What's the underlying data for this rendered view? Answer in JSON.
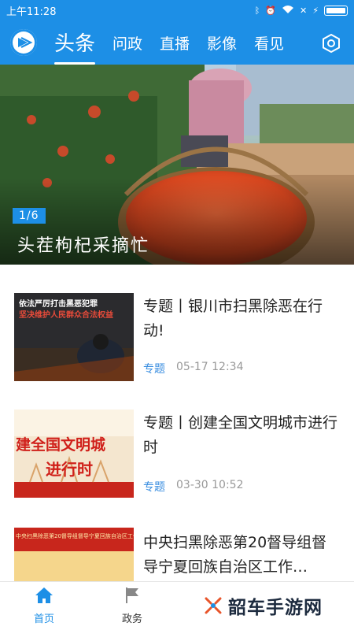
{
  "status_bar": {
    "time": "上午11:28"
  },
  "header": {
    "tabs": [
      {
        "label": "头条",
        "active": true
      },
      {
        "label": "问政",
        "active": false
      },
      {
        "label": "直播",
        "active": false
      },
      {
        "label": "影像",
        "active": false
      },
      {
        "label": "看见",
        "active": false
      }
    ],
    "accent": "#1d8fe6"
  },
  "hero": {
    "page_indicator": "1/6",
    "caption": "头茬枸杞采摘忙"
  },
  "news": [
    {
      "title": "专题丨银川市扫黑除恶在行动!",
      "tag": "专题",
      "time": "05-17 12:34",
      "thumb_text": [
        "依法严厉打击黑恶犯罪",
        "坚决维护人民群众合法权益"
      ]
    },
    {
      "title": "专题丨创建全国文明城市进行时",
      "tag": "专题",
      "time": "03-30 10:52",
      "thumb_text": [
        "建全国文明城",
        "进行时"
      ]
    },
    {
      "title": "中央扫黑除恶第20督导组督导宁夏回族自治区工作…",
      "tag": "",
      "time": "",
      "thumb_text": [
        "中央扫黑除恶第20督导组督导宁夏回族自治区工作动员会"
      ]
    }
  ],
  "bottom_nav": [
    {
      "label": "首页",
      "icon": "home-icon",
      "active": true
    },
    {
      "label": "政务",
      "icon": "flag-icon",
      "active": false
    }
  ],
  "watermark": "韶车手游网"
}
